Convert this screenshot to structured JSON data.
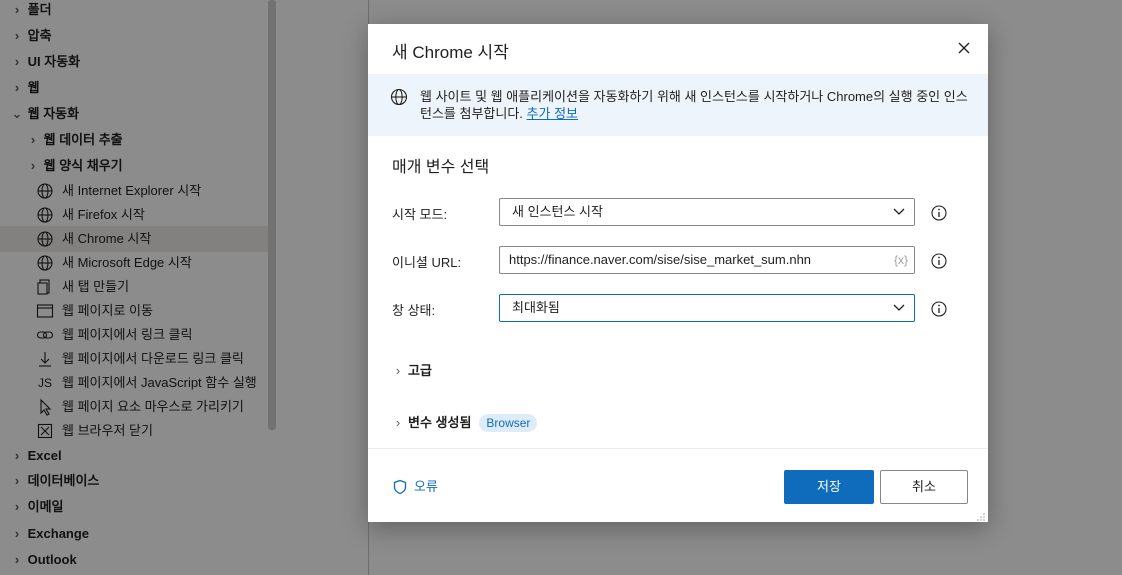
{
  "sidebar": {
    "items": [
      {
        "label": "폴더",
        "type": "group"
      },
      {
        "label": "압축",
        "type": "group"
      },
      {
        "label": "UI 자동화",
        "type": "group"
      },
      {
        "label": "웹",
        "type": "group"
      },
      {
        "label": "웹 자동화",
        "type": "group-open"
      },
      {
        "label": "웹 데이터 추출",
        "type": "subgroup"
      },
      {
        "label": "웹 양식 채우기",
        "type": "subgroup"
      },
      {
        "label": "새 Internet Explorer 시작",
        "icon": "globe-icon"
      },
      {
        "label": "새 Firefox 시작",
        "icon": "globe-icon"
      },
      {
        "label": "새 Chrome 시작",
        "icon": "globe-icon"
      },
      {
        "label": "새 Microsoft Edge 시작",
        "icon": "globe-icon"
      },
      {
        "label": "새 탭 만들기",
        "icon": "new-tab-icon"
      },
      {
        "label": "웹 페이지로 이동",
        "icon": "window-icon"
      },
      {
        "label": "웹 페이지에서 링크 클릭",
        "icon": "link-icon"
      },
      {
        "label": "웹 페이지에서 다운로드 링크 클릭",
        "icon": "download-icon"
      },
      {
        "label": "웹 페이지에서 JavaScript 함수 실행",
        "icon": "js-icon",
        "icon_text": "JS"
      },
      {
        "label": "웹 페이지 요소 마우스로 가리키기",
        "icon": "cursor-icon"
      },
      {
        "label": "웹 브라우저 닫기",
        "icon": "close-box-icon"
      },
      {
        "label": "Excel",
        "type": "group"
      },
      {
        "label": "데이터베이스",
        "type": "group"
      },
      {
        "label": "이메일",
        "type": "group"
      },
      {
        "label": "Exchange",
        "type": "group"
      },
      {
        "label": "Outlook",
        "type": "group"
      }
    ]
  },
  "dialog": {
    "title": "새 Chrome 시작",
    "info_text": "웹 사이트 및 웹 애플리케이션을 자동화하기 위해 새 인스턴스를 시작하거나 Chrome의 실행 중인 인스턴스를 첨부합니다.",
    "info_link": "추가 정보",
    "section_title": "매개 변수 선택",
    "fields": {
      "launch_mode": {
        "label": "시작 모드:",
        "value": "새 인스턴스 시작"
      },
      "initial_url": {
        "label": "이니셜 URL:",
        "value": "https://finance.naver.com/sise/sise_market_sum.nhn",
        "token": "{x}"
      },
      "window_state": {
        "label": "창 상태:",
        "value": "최대화됨"
      }
    },
    "advanced_label": "고급",
    "variables_label": "변수 생성됨",
    "variables_badge": "Browser",
    "error_label": "오류",
    "save_label": "저장",
    "cancel_label": "취소"
  },
  "colors": {
    "accent": "#0f6cbd",
    "info_bar": "#eef4fb",
    "badge_bg": "#deecf9"
  }
}
